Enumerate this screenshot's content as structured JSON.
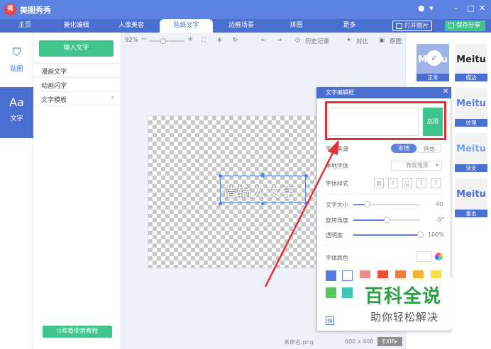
{
  "app": {
    "logo": "秀",
    "title": "美图秀秀",
    "window_icons": [
      "chat-icon",
      "menu-down-icon",
      "minimize-icon",
      "maximize-icon",
      "close-icon"
    ]
  },
  "tabs": [
    {
      "label": "主页"
    },
    {
      "label": "美化编辑"
    },
    {
      "label": "人像美容"
    },
    {
      "label": "贴纸文字"
    },
    {
      "label": "边框场景"
    },
    {
      "label": "拼图"
    },
    {
      "label": "更多"
    }
  ],
  "top_buttons": {
    "open": "打开图片",
    "save": "保存分享"
  },
  "leftnav": [
    {
      "icon": "bookmark-icon",
      "label": "贴图"
    },
    {
      "icon": "text-icon",
      "glyph": "Aa",
      "label": "文字"
    }
  ],
  "panel": {
    "input_button": "输入文字",
    "items": [
      "漫画文字",
      "动画闪字",
      "文字模板"
    ],
    "tutorial": "观看使用教程"
  },
  "toolbar": {
    "zoom": "92%",
    "history": "历史记录",
    "compare": "对比",
    "original": "原图"
  },
  "canvas": {
    "placeholder": "请输入文字",
    "filename": "未命名.png",
    "size": "600 x 400",
    "exif": "EXIF"
  },
  "styles": [
    {
      "sample": "Meitu",
      "label": "正常",
      "selected": true
    },
    {
      "sample": "Meitu",
      "label": "描边"
    },
    {
      "sample": "Meitu",
      "label": "纹理"
    },
    {
      "sample": "Meitu",
      "label": "渐变"
    },
    {
      "sample": "Meitu",
      "label": "重击"
    }
  ],
  "dialog": {
    "title": "文字编辑框",
    "apply": "应用",
    "font_source_label": "字体来源",
    "source_local": "本地",
    "source_web": "网络",
    "local_font_label": "本地字体",
    "local_font_value": "微软雅黑",
    "font_style_label": "字体样式",
    "style_buttons": [
      "B",
      "I",
      "U",
      "T",
      "T"
    ],
    "size_label": "文字大小",
    "size_value": "40",
    "size_fraction": 0.2,
    "rotate_label": "旋转角度",
    "rotate_value": "0°",
    "rotate_fraction": 0.5,
    "opacity_label": "透明度",
    "opacity_value": "100%",
    "opacity_fraction": 1.0,
    "color_label": "字体颜色",
    "swatches": [
      "#5b7be0",
      "#ffffff",
      "#f08a8a",
      "#e8503c",
      "#f07a3a",
      "#f4b43a",
      "#f7dd4a",
      "#58c65a",
      "#3fc7b5"
    ]
  },
  "watermark": {
    "main": "百科全说",
    "sub": "助你轻松解决"
  },
  "colors": {
    "brand": "#5b82e0",
    "accent": "#3ec48c",
    "highlight": "#e0303a"
  }
}
